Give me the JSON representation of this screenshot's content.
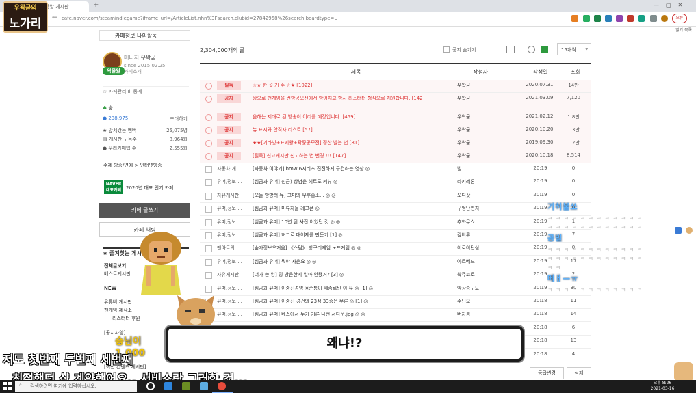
{
  "browser": {
    "tab_title": "진행중인 게시판 · 중앙 게시판",
    "url": "cafe.naver.com/steamindiegame?iframe_url=/ArticleList.nhn%3Fsearch.clubid=27842958%26search.boardtype=L",
    "profile_label": "오류",
    "bookmarks_label": "읽기 목록"
  },
  "stream_logo": {
    "top": "우왁굳의",
    "main": "노가리"
  },
  "sidebar": {
    "tabs": "카페정보  나의활동",
    "manager_label": "매니저",
    "manager_name": "우왁굳",
    "since": "since 2015.02.25.",
    "cafe_intro": "카페소개",
    "avatar_label": "왁물원",
    "links": "☆ 카페관리   ılı 통계",
    "grade": "숲",
    "members": "238,975",
    "invite": "초대하기",
    "stats": [
      {
        "label": "★ 앞서갔든 멤버",
        "value": "25,075명"
      },
      {
        "label": "▤ 게시판 구독수",
        "value": "8,964회"
      },
      {
        "label": "● 우리카페앱 수",
        "value": "2,555회"
      }
    ],
    "category": "주제  방송/연예 > 인터넷방송",
    "naver_badge": "NAVER 대표카페",
    "cafe_rank": "2020년 대표 인기 카페",
    "write_button": "카페 글쓰기",
    "chat_button": "카페 채팅",
    "favorites": "★ 즐겨찾는 게시판",
    "menu": [
      "전체글보기",
      "베스트게시판",
      "NEW",
      "유튜버 게시판",
      "팬게임 제작소",
      "리스터터 후원",
      "[공지사항]",
      "[최신 컨텐츠 게시판]"
    ]
  },
  "list": {
    "count": "2,304,000개의 글",
    "notice_hide": "공지 숨기기",
    "per_page": "15개씩",
    "headers": {
      "title": "제목",
      "author": "작성자",
      "date": "작성일",
      "views": "조회"
    },
    "notices": [
      {
        "tag": "필독",
        "title": "☆★ 한 섯 기 주 ☆★ [1022]",
        "author": "우왁굳",
        "date": "2020.07.31.",
        "views": "14만"
      },
      {
        "tag": "공지",
        "title": "왕으로 팬게임을 번방공모전에서 방어지고 항시 리스터터 형식으로 지원합니다. [142]",
        "author": "우왁굳",
        "date": "2021.03.09.",
        "views": "7,120"
      },
      {
        "tag": "공지",
        "title": "음해는 제대로 된 방송이 이리를 예정입니다. [459]",
        "author": "우왁굳",
        "date": "2021.02.12.",
        "views": "1.8만"
      },
      {
        "tag": "공지",
        "title": "뉴 표시와 합격자 리스트 [57]",
        "author": "우왁굳",
        "date": "2020.10.20.",
        "views": "1.3만"
      },
      {
        "tag": "공지",
        "title": "★★[기라빙+표지왕+곽중공모전] 정산 발는 법 [81]",
        "author": "우왁굳",
        "date": "2019.09.30.",
        "views": "1.2만"
      },
      {
        "tag": "공지",
        "title": "[필독] 신고게시판 신고하는 법 변경 !!! [147]",
        "author": "우왁굳",
        "date": "2020.10.18.",
        "views": "8,514"
      }
    ],
    "posts": [
      {
        "cat": "자동차 게...",
        "title": "[자동차 이야기] bmw 6시리즈 진진하게 구건하는 영상 ◎",
        "author": "빌",
        "date": "20:19",
        "views": "0"
      },
      {
        "cat": "유머,정보 ...",
        "title": "[심금과 유머] 심금) 상범운 헤르도 커뷰 ◎",
        "author": "라키레톤",
        "date": "20:19",
        "views": "0"
      },
      {
        "cat": "자유게시판",
        "title": "[오늘 방방터 뮤] 고미의 우후흥소... ◎ ◎",
        "author": "오디잣",
        "date": "20:19",
        "views": "0"
      },
      {
        "cat": "유머,정보 ...",
        "title": "[심금과 유머] 미뷰자들 레고픈 ◎",
        "author": "구멍난편치",
        "date": "20:19",
        "views": "0"
      },
      {
        "cat": "유머,정보 ...",
        "title": "[심금과 유머] 10년 된 사진 이었던 것 ◎ ◎",
        "author": "추화무쇼",
        "date": "20:19",
        "views": "1"
      },
      {
        "cat": "유머,정보 ...",
        "title": "[심금과 유머] 허그로 매어제를 만든기 [1] ◎",
        "author": "감비류",
        "date": "20:19",
        "views": "7"
      },
      {
        "cat": "팬아트의 ...",
        "title": "[숲가정보오거움] 《스팀》 방구리케임 노드게임 ◎ ◎",
        "author": "이로이탄심",
        "date": "20:19",
        "views": "0"
      },
      {
        "cat": "유머,정보 ...",
        "title": "[심금과 유머] 뭐야 자은요 ◎ ◎",
        "author": "아르베드",
        "date": "20:19",
        "views": "17"
      },
      {
        "cat": "자유게시판",
        "title": "[너가 쓴 잉] 잉 방은한지 얼마 안됐거? [3] ◎",
        "author": "왁쥬코로",
        "date": "20:19",
        "views": "2"
      },
      {
        "cat": "유머,정보 ...",
        "title": "[심금과 유머] 이중신경명 ※순통이 세좀르틴 이 유 ◎ [1] ◎",
        "author": "악상승구도",
        "date": "20:19",
        "views": "30"
      },
      {
        "cat": "유머,정보 ...",
        "title": "[심금과 유머] 이중신 경건의 23점 33승은 무른 ◎ [1] ◎",
        "author": "주닌오",
        "date": "20:18",
        "views": "11"
      },
      {
        "cat": "유머,정보 ...",
        "title": "[심금과 유머] 베스에서 누가 기론 나전 서다운.jpg ◎ ◎",
        "author": "버자봄",
        "date": "20:18",
        "views": "14"
      },
      {
        "cat": "",
        "title": "",
        "author": "",
        "date": "20:18",
        "views": "6"
      },
      {
        "cat": "",
        "title": "",
        "author": "",
        "date": "20:18",
        "views": "13"
      },
      {
        "cat": "",
        "title": "",
        "author": "",
        "date": "20:18",
        "views": "4"
      }
    ],
    "level_button": "등급변경",
    "delete_button": "삭제"
  },
  "chat_overlay": [
    {
      "text": "기허불쏘",
      "kind": "name"
    },
    {
      "text": "ㅋ ㅋ ㅋ ㅋ ㅋ ㅋ ㅋ ㅋ ㅋ ㅋ ㅋ ㅋ",
      "kind": "msg"
    },
    {
      "text": "ㅋ ㅋ ㅋ ㅋ ㅋ ㅋ ㅋ ㅋ ㅋ ㅋ ㅋ ㅋ",
      "kind": "msg"
    },
    {
      "text": "공벌",
      "kind": "name"
    },
    {
      "text": "ㅋ ㅋ ㅋ ㅋ ㅋ ㅋ ㅋ ㅋ ㅋ ㅋ ㅋ ㅋ",
      "kind": "msg"
    },
    {
      "text": "ㅋ ㅋ ㅋ ㅋ ㅋ ㅋ ㅋ ㅋ ㅋ ㅋ ㅋ ㅋ",
      "kind": "msg"
    },
    {
      "text": "ㅋ ㅋ",
      "kind": "msg"
    },
    {
      "text": "메ㅐ—ㅠ",
      "kind": "name"
    },
    {
      "text": "ㅋ ㅋ ㅋ ㅋ ㅋ ㅋ ㅋ ㅋ ㅋ ㅋ ㅋ ㅋ",
      "kind": "msg"
    }
  ],
  "overlay": {
    "dialog": "왜냐!?",
    "hp": "승님이 1,000",
    "subtitle_1": "저도 첫번째 두번째 세번째",
    "subtitle_2": "친절했던 샵 계약했어요.. 서비스랑 그러한 것..."
  },
  "taskbar": {
    "search_placeholder": "검색하려면 여기에 입력하십시오.",
    "time": "오후 8:26",
    "date": "2021-03-16"
  },
  "colors": {
    "notice_red": "#d33333",
    "chat_name": "#5ab2ff",
    "taskbar": "#1c1c1c"
  }
}
